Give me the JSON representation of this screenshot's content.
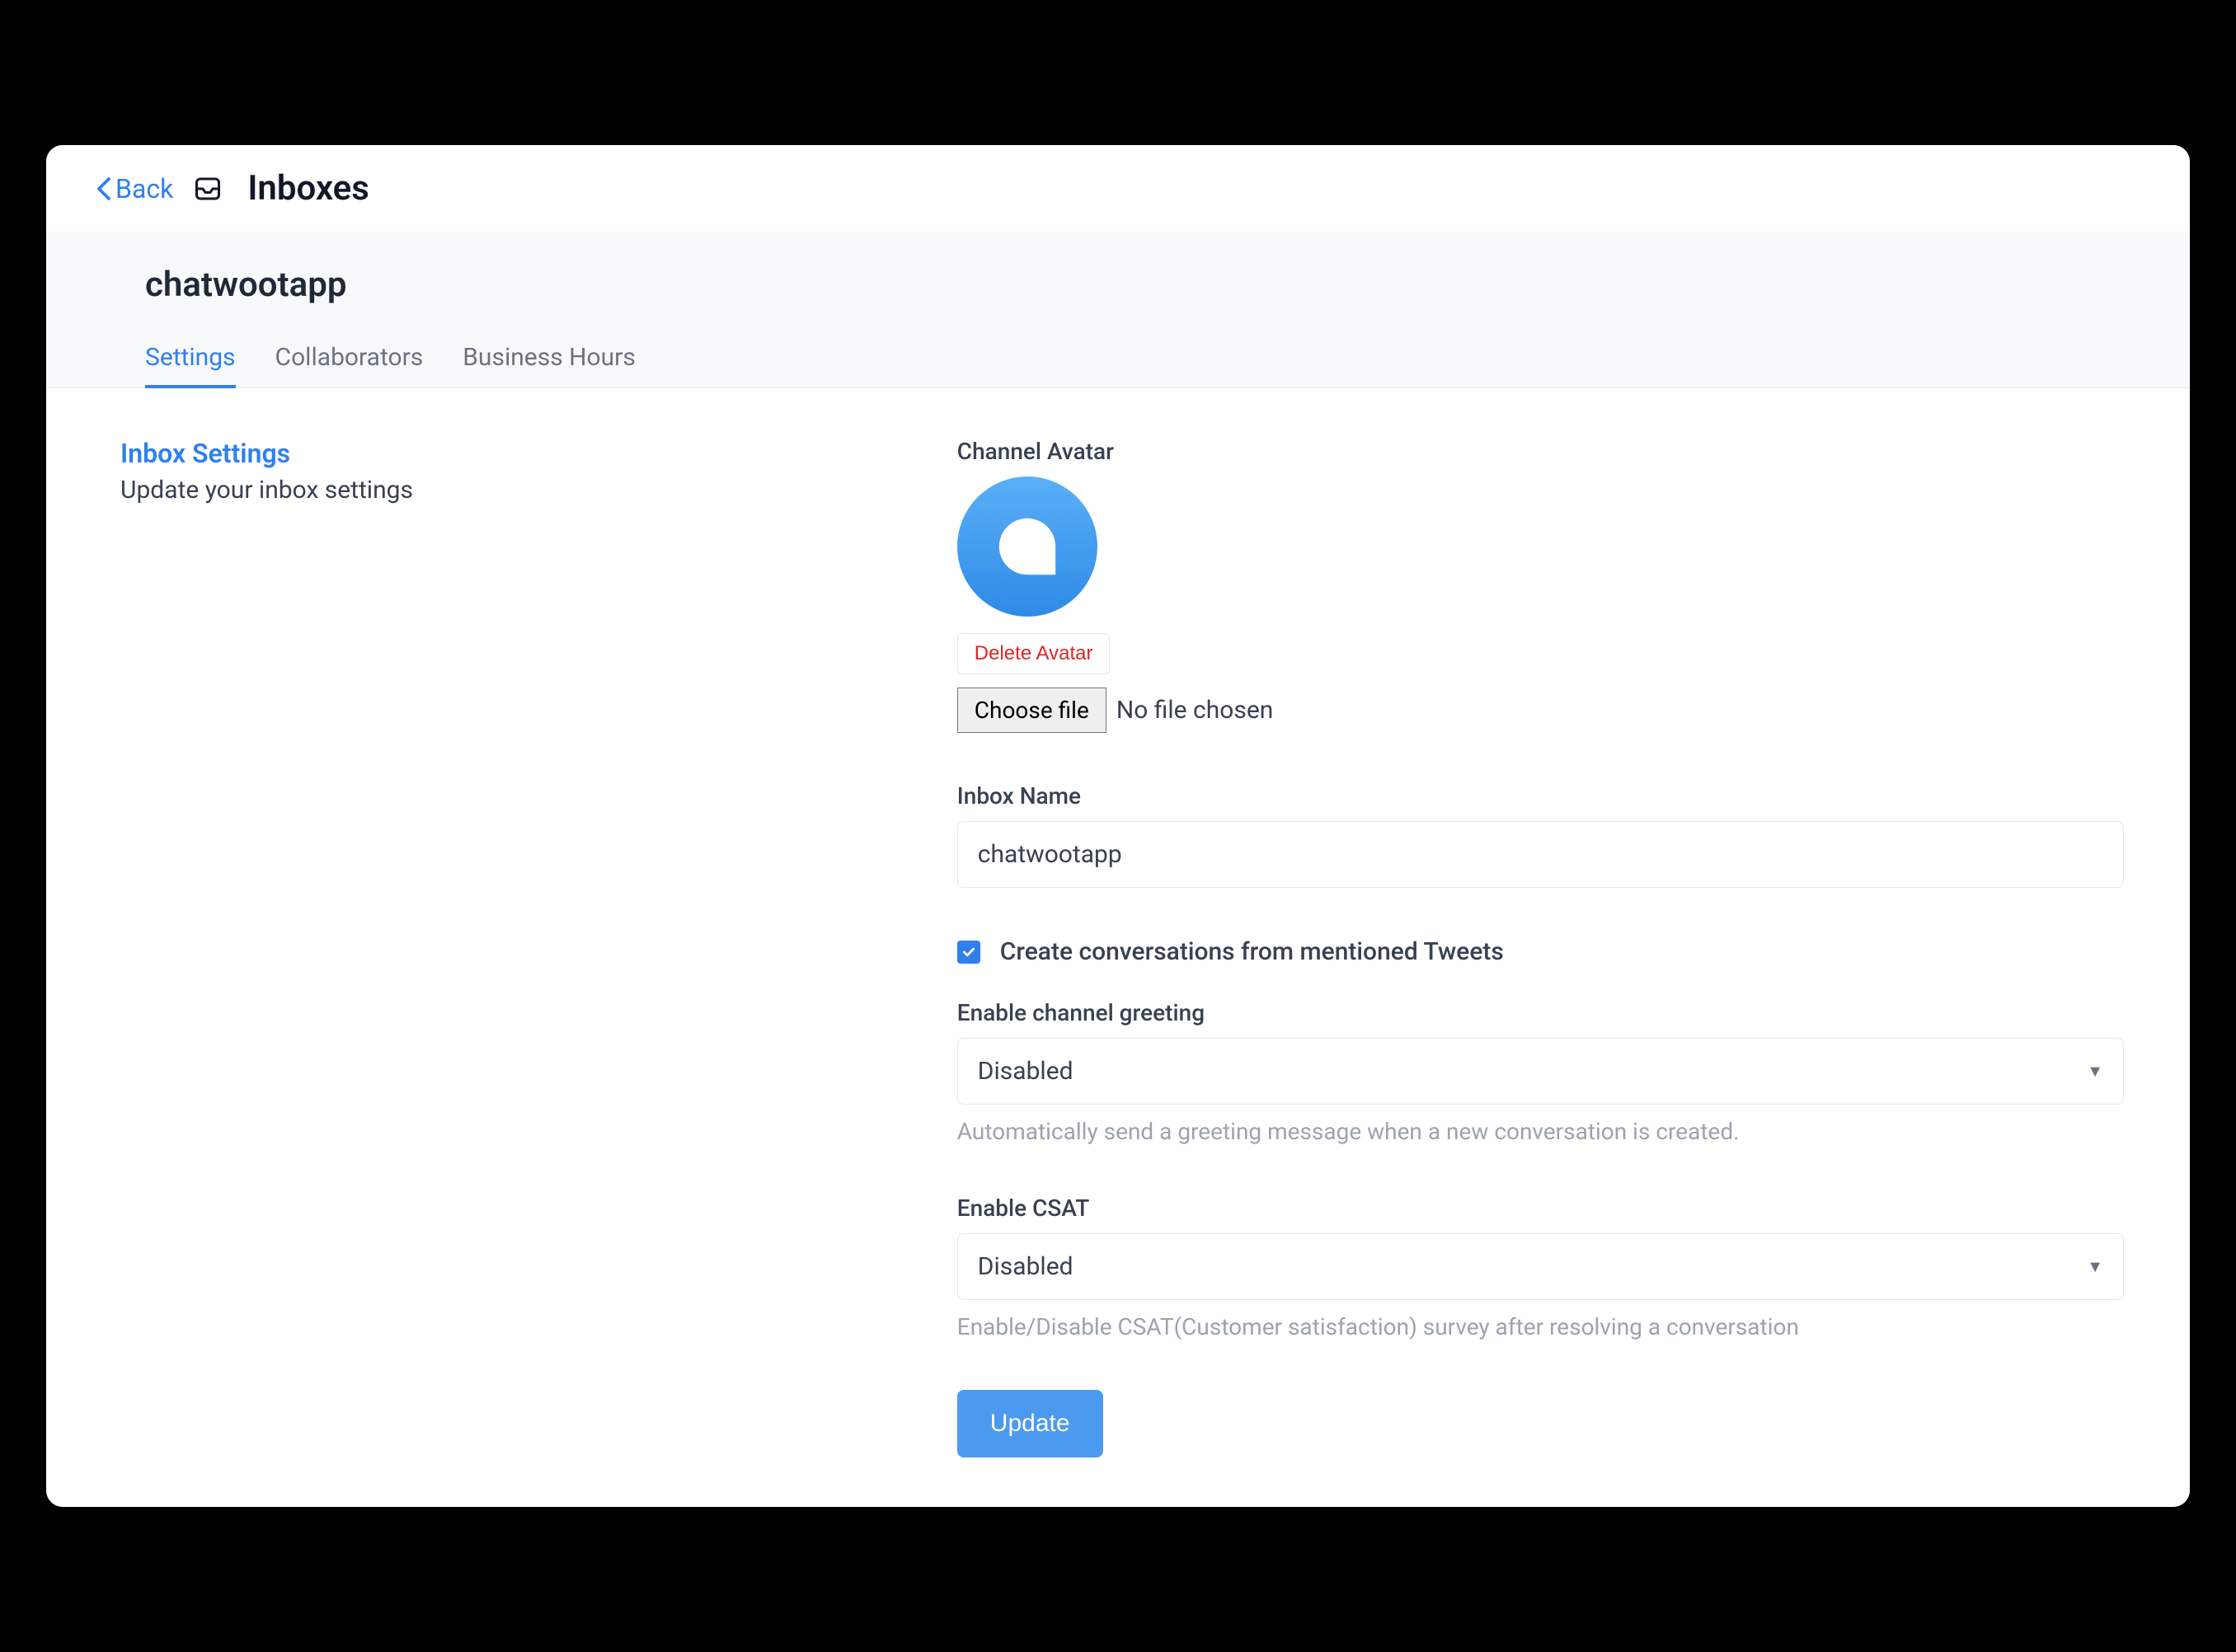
{
  "header": {
    "back_label": "Back",
    "page_title": "Inboxes"
  },
  "inbox": {
    "name": "chatwootapp"
  },
  "tabs": [
    {
      "label": "Settings",
      "active": true
    },
    {
      "label": "Collaborators",
      "active": false
    },
    {
      "label": "Business Hours",
      "active": false
    }
  ],
  "sidebar": {
    "title": "Inbox Settings",
    "description": "Update your inbox settings"
  },
  "form": {
    "avatar": {
      "label": "Channel Avatar",
      "delete_label": "Delete Avatar",
      "choose_file_label": "Choose file",
      "file_status": "No file chosen"
    },
    "inbox_name": {
      "label": "Inbox Name",
      "value": "chatwootapp"
    },
    "mentioned_tweets": {
      "label": "Create conversations from mentioned Tweets",
      "checked": true
    },
    "greeting": {
      "label": "Enable channel greeting",
      "value": "Disabled",
      "help": "Automatically send a greeting message when a new conversation is created."
    },
    "csat": {
      "label": "Enable CSAT",
      "value": "Disabled",
      "help": "Enable/Disable CSAT(Customer satisfaction) survey after resolving a conversation"
    },
    "submit_label": "Update"
  }
}
